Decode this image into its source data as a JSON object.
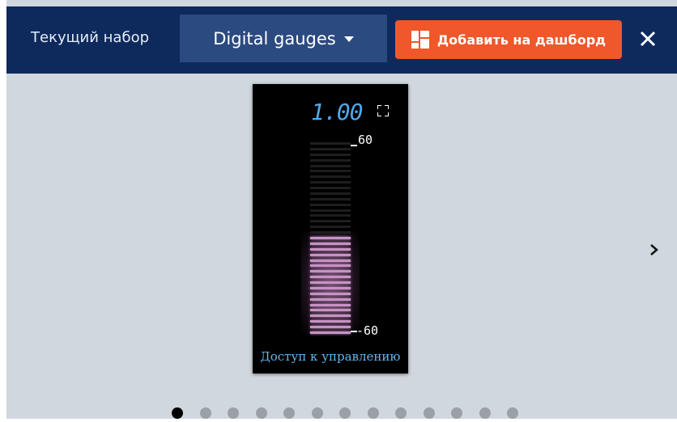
{
  "header": {
    "set_label": "Текущий набор",
    "set_selected": "Digital gauges",
    "add_button_label": "Добавить на дашборд",
    "close_icon": "close-icon",
    "add_icon": "dashboard-icon"
  },
  "gauge": {
    "value": "1.00",
    "max_label": "60",
    "min_label": "-60",
    "fill_fraction": 0.5,
    "access_link": "Доступ к управлению",
    "fullscreen_icon": "fullscreen-icon"
  },
  "carousel": {
    "next_icon": "chevron-right-icon",
    "total_pages": 13,
    "active_page": 1
  },
  "colors": {
    "header_bg": "#0e2a5d",
    "select_bg": "#2b4a80",
    "accent": "#f0572a",
    "value_color": "#4fa8e8",
    "bar_on": "#c792c4",
    "page_bg": "#d0d7de"
  }
}
